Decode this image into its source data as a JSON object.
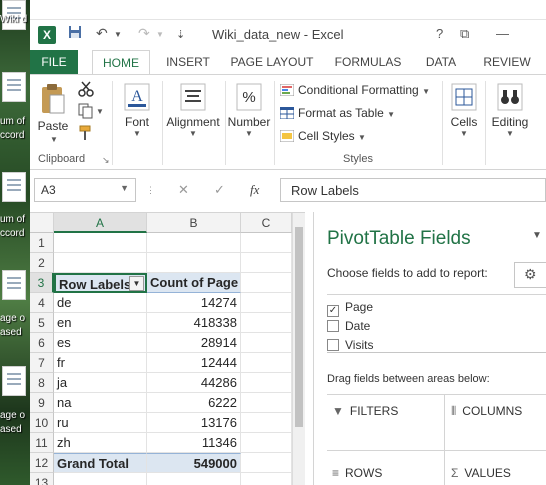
{
  "desktop": {
    "labels": [
      "Wiki d",
      "um of",
      "ccord",
      "um of",
      "ccord",
      "age o",
      "ased",
      "age o",
      "ased"
    ]
  },
  "window": {
    "title": "Wiki_data_new - Excel",
    "icons": [
      "excel-logo",
      "save-icon",
      "undo-icon",
      "redo-icon",
      "customize-icon"
    ],
    "controls": {
      "help": "?",
      "restore": "⧉",
      "minimize": "—"
    }
  },
  "tabs": {
    "file": "FILE",
    "home": "HOME",
    "insert": "INSERT",
    "page_layout": "PAGE LAYOUT",
    "formulas": "FORMULAS",
    "data": "DATA",
    "review": "REVIEW"
  },
  "ribbon": {
    "paste": "Paste",
    "clipboard": "Clipboard",
    "font": "Font",
    "alignment": "Alignment",
    "number": "Number",
    "conditional_formatting": "Conditional Formatting",
    "format_as_table": "Format as Table",
    "cell_styles": "Cell Styles",
    "styles": "Styles",
    "cells": "Cells",
    "editing": "Editing"
  },
  "formula_bar": {
    "name_box": "A3",
    "fx": "fx",
    "content": "Row Labels"
  },
  "grid": {
    "columns": [
      "A",
      "B",
      "C"
    ],
    "rows": [
      "1",
      "2",
      "3",
      "4",
      "5",
      "6",
      "7",
      "8",
      "9",
      "10",
      "11",
      "12",
      "13"
    ],
    "header": {
      "label": "Row Labels",
      "value": "Count of Page"
    },
    "data": [
      {
        "label": "de",
        "value": "14274"
      },
      {
        "label": "en",
        "value": "418338"
      },
      {
        "label": "es",
        "value": "28914"
      },
      {
        "label": "fr",
        "value": "12444"
      },
      {
        "label": "ja",
        "value": "44286"
      },
      {
        "label": "na",
        "value": "6222"
      },
      {
        "label": "ru",
        "value": "13176"
      },
      {
        "label": "zh",
        "value": "11346"
      }
    ],
    "total": {
      "label": "Grand Total",
      "value": "549000"
    }
  },
  "pivot": {
    "title": "PivotTable Fields",
    "subtitle": "Choose fields to add to report:",
    "fields": [
      {
        "name": "Page",
        "checked": true
      },
      {
        "name": "Date",
        "checked": false
      },
      {
        "name": "Visits",
        "checked": false
      }
    ],
    "drag_label": "Drag fields between areas below:",
    "areas": {
      "filters": "FILTERS",
      "columns": "COLUMNS",
      "rows": "ROWS",
      "values": "VALUES"
    }
  },
  "colors": {
    "accent": "#217346",
    "pivot_header": "#dce6f1"
  }
}
